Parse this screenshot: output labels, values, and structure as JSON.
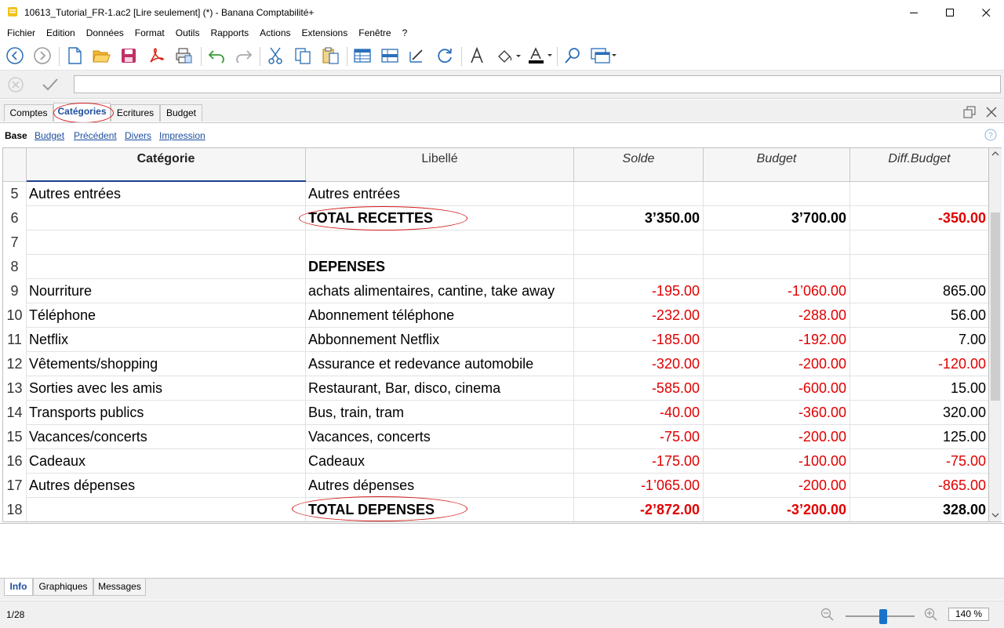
{
  "window": {
    "title": "10613_Tutorial_FR-1.ac2 [Lire seulement] (*) - Banana Comptabilité+",
    "minimize": "—",
    "maximize": "☐",
    "close": "✕"
  },
  "menu": [
    "Fichier",
    "Edition",
    "Données",
    "Format",
    "Outils",
    "Rapports",
    "Actions",
    "Extensions",
    "Fenêtre",
    "?"
  ],
  "tabs": [
    "Comptes",
    "Catégories",
    "Ecritures",
    "Budget"
  ],
  "active_tab": "Catégories",
  "views": {
    "base": "Base",
    "links": [
      "Budget",
      "Précédent",
      "Divers",
      "Impression"
    ]
  },
  "table": {
    "headers": {
      "categorie": "Catégorie",
      "libelle": "Libellé",
      "solde": "Solde",
      "budget": "Budget",
      "diff": "Diff.Budget"
    },
    "rows": [
      {
        "num": "5",
        "cat": "Autres entrées",
        "lib": "Autres entrées",
        "solde": "",
        "budget": "",
        "diff": "",
        "style": "normal"
      },
      {
        "num": "6",
        "cat": "",
        "lib": "TOTAL RECETTES",
        "solde": "3’350.00",
        "budget": "3’700.00",
        "diff": "-350.00",
        "style": "total"
      },
      {
        "num": "7",
        "cat": "",
        "lib": "",
        "solde": "",
        "budget": "",
        "diff": "",
        "style": "normal"
      },
      {
        "num": "8",
        "cat": "",
        "lib": "DEPENSES",
        "solde": "",
        "budget": "",
        "diff": "",
        "style": "heading"
      },
      {
        "num": "9",
        "cat": "Nourriture",
        "lib": "achats alimentaires, cantine, take away",
        "solde": "-195.00",
        "budget": "-1’060.00",
        "diff": "865.00",
        "style": "normal"
      },
      {
        "num": "10",
        "cat": "Téléphone",
        "lib": "Abonnement téléphone",
        "solde": "-232.00",
        "budget": "-288.00",
        "diff": "56.00",
        "style": "normal"
      },
      {
        "num": "11",
        "cat": "Netflix",
        "lib": "Abbonnement Netflix",
        "solde": "-185.00",
        "budget": "-192.00",
        "diff": "7.00",
        "style": "normal"
      },
      {
        "num": "12",
        "cat": "Vêtements/shopping",
        "lib": "Assurance et redevance automobile",
        "solde": "-320.00",
        "budget": "-200.00",
        "diff": "-120.00",
        "style": "normal"
      },
      {
        "num": "13",
        "cat": "Sorties avec les amis",
        "lib": "Restaurant, Bar, disco, cinema",
        "solde": "-585.00",
        "budget": "-600.00",
        "diff": "15.00",
        "style": "normal"
      },
      {
        "num": "14",
        "cat": "Transports publics",
        "lib": "Bus, train, tram",
        "solde": "-40.00",
        "budget": "-360.00",
        "diff": "320.00",
        "style": "normal"
      },
      {
        "num": "15",
        "cat": "Vacances/concerts",
        "lib": "Vacances, concerts",
        "solde": "-75.00",
        "budget": "-200.00",
        "diff": "125.00",
        "style": "normal"
      },
      {
        "num": "16",
        "cat": "Cadeaux",
        "lib": "Cadeaux",
        "solde": "-175.00",
        "budget": "-100.00",
        "diff": "-75.00",
        "style": "normal"
      },
      {
        "num": "17",
        "cat": "Autres dépenses",
        "lib": "Autres dépenses",
        "solde": "-1’065.00",
        "budget": "-200.00",
        "diff": "-865.00",
        "style": "normal"
      },
      {
        "num": "18",
        "cat": "",
        "lib": "TOTAL DEPENSES",
        "solde": "-2’872.00",
        "budget": "-3’200.00",
        "diff": "328.00",
        "style": "total"
      }
    ]
  },
  "bottom_tabs": [
    "Info",
    "Graphiques",
    "Messages"
  ],
  "active_bottom_tab": "Info",
  "status": {
    "position": "1/28",
    "zoom": "140 %",
    "zoom_level_percent": 140
  },
  "colors": {
    "negative": "#e00000",
    "accent": "#1f4fa0",
    "annotation": "#d01c1c"
  }
}
